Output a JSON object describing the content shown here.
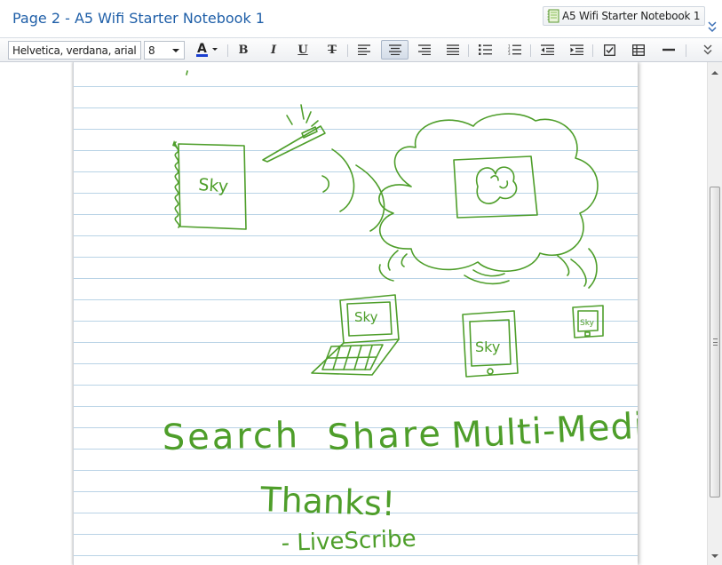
{
  "header": {
    "page_title": "Page 2 - A5 Wifi Starter Notebook 1",
    "notebook_selector": {
      "label": "A5 Wifi Starter Notebook 1",
      "icon": "notebook-icon"
    }
  },
  "toolbar": {
    "font_family": "Helvetica, verdana, arial",
    "font_size": "8",
    "text_color": "#1a3fd0",
    "buttons": [
      {
        "name": "text-color-button",
        "glyph": "A"
      },
      {
        "name": "bold-button",
        "glyph": "B"
      },
      {
        "name": "italic-button",
        "glyph": "I"
      },
      {
        "name": "underline-button",
        "glyph": "U"
      },
      {
        "name": "strikethrough-button",
        "glyph": "T"
      },
      {
        "name": "align-left-button",
        "icon": "align-left-icon"
      },
      {
        "name": "align-center-button",
        "icon": "align-center-icon",
        "active": true
      },
      {
        "name": "align-right-button",
        "icon": "align-right-icon"
      },
      {
        "name": "justify-button",
        "icon": "justify-icon"
      },
      {
        "name": "bullet-list-button",
        "icon": "bullet-list-icon"
      },
      {
        "name": "numbered-list-button",
        "icon": "numbered-list-icon"
      },
      {
        "name": "outdent-button",
        "icon": "outdent-icon"
      },
      {
        "name": "indent-button",
        "icon": "indent-icon"
      },
      {
        "name": "checkbox-button",
        "icon": "checkbox-icon"
      },
      {
        "name": "table-button",
        "icon": "table-icon"
      },
      {
        "name": "horizontal-rule-button",
        "icon": "horizontal-rule-icon"
      }
    ]
  },
  "page": {
    "ink_color": "#4e9e2a",
    "rule_color": "#b9d3e6",
    "handwriting": {
      "notebook_word": "Sky",
      "laptop_word": "Sky",
      "tablet_word": "Sky",
      "phone_word": "Sky",
      "word_search": "Search",
      "word_share": "Share",
      "word_multimedia": "Multi-Media",
      "thanks": "Thanks!",
      "signature": "- LiveScribe"
    }
  }
}
